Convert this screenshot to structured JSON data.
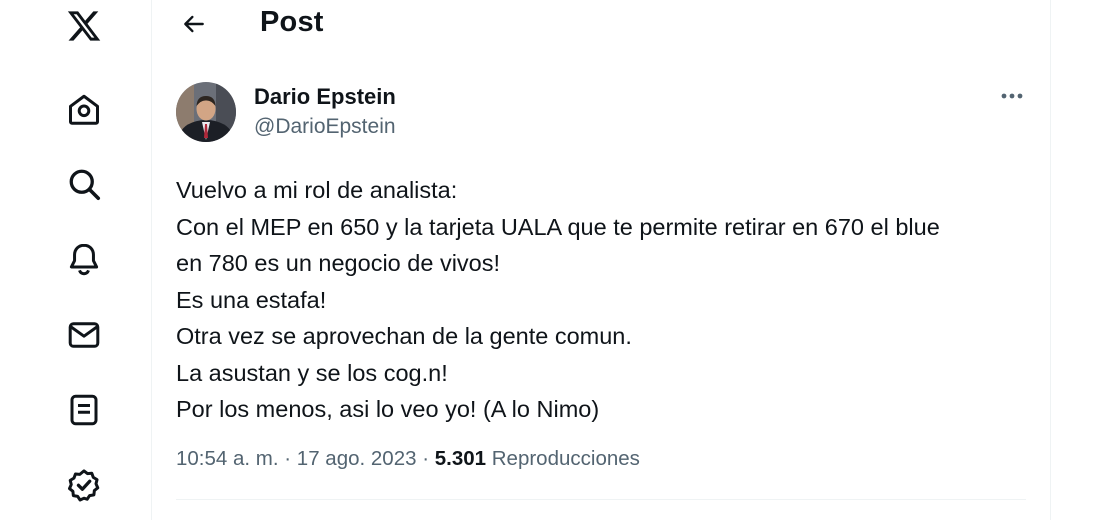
{
  "header": {
    "title": "Post"
  },
  "sidebar": {
    "icons": [
      "x-logo",
      "home-icon",
      "search-icon",
      "notifications-icon",
      "messages-icon",
      "lists-icon",
      "verified-icon"
    ]
  },
  "tweet": {
    "author_name": "Dario Epstein",
    "author_handle": "@DarioEpstein",
    "lines": [
      "Vuelvo a mi rol de analista:",
      "Con el MEP en 650 y la tarjeta UALA que te permite retirar en 670 el blue",
      "en 780 es un negocio de vivos!",
      "Es una estafa!",
      "Otra vez se aprovechan de la gente comun.",
      "La asustan y se los cog.n!",
      "Por los menos, asi lo veo yo! (A lo Nimo)"
    ],
    "time": "10:54 a. m.",
    "separator": "·",
    "date": "17 ago. 2023",
    "views_count": "5.301",
    "views_label": "Reproducciones"
  },
  "colors": {
    "text": "#0f1419",
    "secondary": "#536471",
    "border": "#eff3f4"
  }
}
